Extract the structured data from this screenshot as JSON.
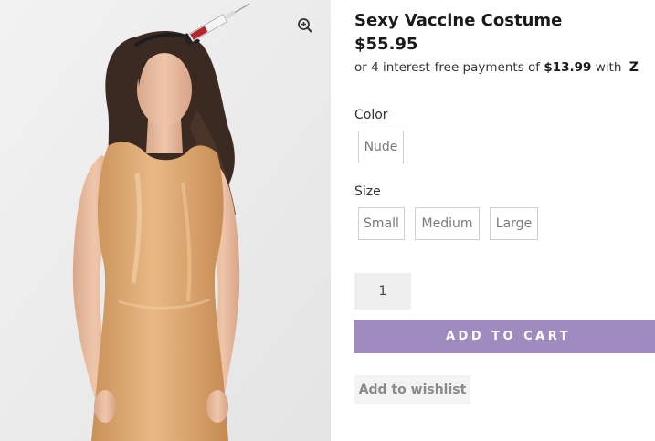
{
  "product": {
    "title": "Sexy Vaccine Costume",
    "price": "$55.95",
    "installments": {
      "prefix": "or 4 interest-free payments of",
      "amount": "$13.99",
      "suffix": "with",
      "provider_logo": "Z"
    },
    "image": {
      "alt_icon": "model-in-nude-latex-dress-image",
      "zoom_icon": "zoom-in-icon"
    }
  },
  "options": {
    "color": {
      "label": "Color",
      "values": [
        "Nude"
      ]
    },
    "size": {
      "label": "Size",
      "values": [
        "Small",
        "Medium",
        "Large"
      ]
    }
  },
  "purchase": {
    "quantity": "1",
    "add_to_cart_label": "ADD TO CART",
    "wishlist_label": "Add to wishlist"
  },
  "colors": {
    "accent": "#a08bbf",
    "dress": "#d9a46e",
    "background_image": "#ebebeb"
  }
}
